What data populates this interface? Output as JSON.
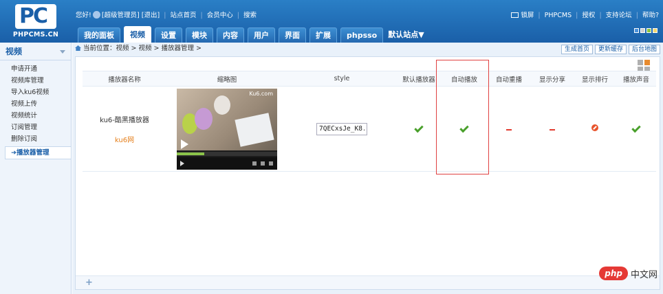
{
  "brand": {
    "logo_mark": "PC",
    "logo_name": "PHPCMS.CN"
  },
  "header": {
    "greeting": "您好!",
    "user_role": "[超级管理员]",
    "logout": "[退出]",
    "links": [
      "站点首页",
      "会员中心",
      "搜索"
    ],
    "right_links": [
      "锁屏",
      "PHPCMS",
      "授权",
      "支持论坛",
      "帮助?"
    ]
  },
  "nav": {
    "tabs": [
      "我的面板",
      "视频",
      "设置",
      "模块",
      "内容",
      "用户",
      "界面",
      "扩展",
      "phpsso"
    ],
    "active": "视频",
    "site_selector": "默认站点▼"
  },
  "sidebar": {
    "title": "视频",
    "items": [
      "申请开通",
      "视频库管理",
      "导入ku6视频",
      "视频上传",
      "视频统计",
      "订阅管理",
      "删除订阅",
      "播放器管理"
    ],
    "active": "播放器管理"
  },
  "breadcrumb": {
    "label": "当前位置：视频 > 视频 > 播放器管理 >"
  },
  "crumb_buttons": [
    "生成首页",
    "更新缓存",
    "后台地图"
  ],
  "table": {
    "headers": [
      "播放器名称",
      "缩略图",
      "style",
      "默认播放器",
      "自动播放",
      "自动重播",
      "显示分享",
      "显示排行",
      "播放声音"
    ],
    "row": {
      "name": "ku6-酷黑播放器",
      "link": "ku6网",
      "thumb_brand": "Ku6.com",
      "style_value": "7QECxsJe_K8.",
      "cells": [
        "ok-icon",
        "ok-icon",
        "dash-icon",
        "dash-icon",
        "ban-icon",
        "ok-icon"
      ]
    }
  },
  "watermark": {
    "pill": "php",
    "text": "中文网"
  },
  "colors": {
    "header": "#1a5fa8",
    "accent_orange": "#e57f1b",
    "ok_green": "#4aa02c",
    "no_red": "#e23a2e",
    "highlight_box": "#e04040"
  }
}
